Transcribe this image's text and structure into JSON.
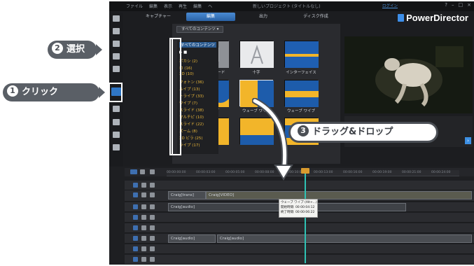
{
  "app": {
    "menu": [
      "ファイル",
      "編集",
      "表示",
      "再生",
      "編集",
      "ヘ"
    ],
    "project_title": "新しいプロジェクト (タイトルなし)",
    "login": "ログイン",
    "window_controls": [
      "?",
      "–",
      "□",
      "×"
    ],
    "brand": "PowerDirector",
    "brand_color": "#3d8ee8"
  },
  "tabs": [
    {
      "label": "キャプチャー",
      "active": false
    },
    {
      "label": "編集",
      "active": true
    },
    {
      "label": "出力",
      "active": false
    },
    {
      "label": "ディスク作成",
      "active": false
    }
  ],
  "library": {
    "filter_label": "すべてのコンテンツ ▾",
    "categories": [
      "すべてのコンテンツ",
      "▶ ■",
      "ボカシ (2)",
      "ロ (16)",
      "3D (10)",
      "フォトン (36)",
      "ルイプ (13)",
      "トライプ (33)",
      "ワイプ (7)",
      "スライド (38)",
      "マルチピ (10)",
      "スライド (22)",
      "ズーム (8)",
      "3D ビラ (25)",
      "ライプ (17)"
    ],
    "thumbnails": [
      {
        "label": "アップグレード",
        "style": "gray"
      },
      {
        "label": "十字",
        "style": "white"
      },
      {
        "label": "インターフェイス",
        "style": "blue-yellow"
      },
      {
        "label": "ウェーブ",
        "style": "wave"
      },
      {
        "label": "ウェーブ ワイプ",
        "style": "split"
      },
      {
        "label": "ウェーブ ワイプ",
        "style": "wave"
      },
      {
        "label": "",
        "style": "split"
      },
      {
        "label": "",
        "style": "split"
      },
      {
        "label": "",
        "style": "blue-yellow"
      }
    ]
  },
  "timeline": {
    "ruler_ticks": [
      "00:00:00:00",
      "00:00:03:00",
      "00:00:05:00",
      "00:00:08:00",
      "00:00:10:00",
      "00:00:13:00",
      "00:00:16:00",
      "00:00:19:00",
      "00:00:21:00",
      "00:00:24:00"
    ],
    "clips": [
      {
        "text": "Craig[trans]"
      },
      {
        "text": "Craig[VIDEO]"
      },
      {
        "text": "Craig[audio]"
      },
      {
        "text": "Craig[audio]"
      },
      {
        "text": "Craig[audio]"
      }
    ],
    "tooltip": [
      "ウェーブ ワイプ (Alt+...)",
      "開始時間: 00:00:04:12",
      "終了時間: 00:00:06:22"
    ]
  },
  "callouts": {
    "click": {
      "number": "1",
      "text": "クリック"
    },
    "select": {
      "number": "2",
      "text": "選択"
    },
    "drag": {
      "number": "3",
      "text": "ドラッグ&ドロップ"
    }
  }
}
